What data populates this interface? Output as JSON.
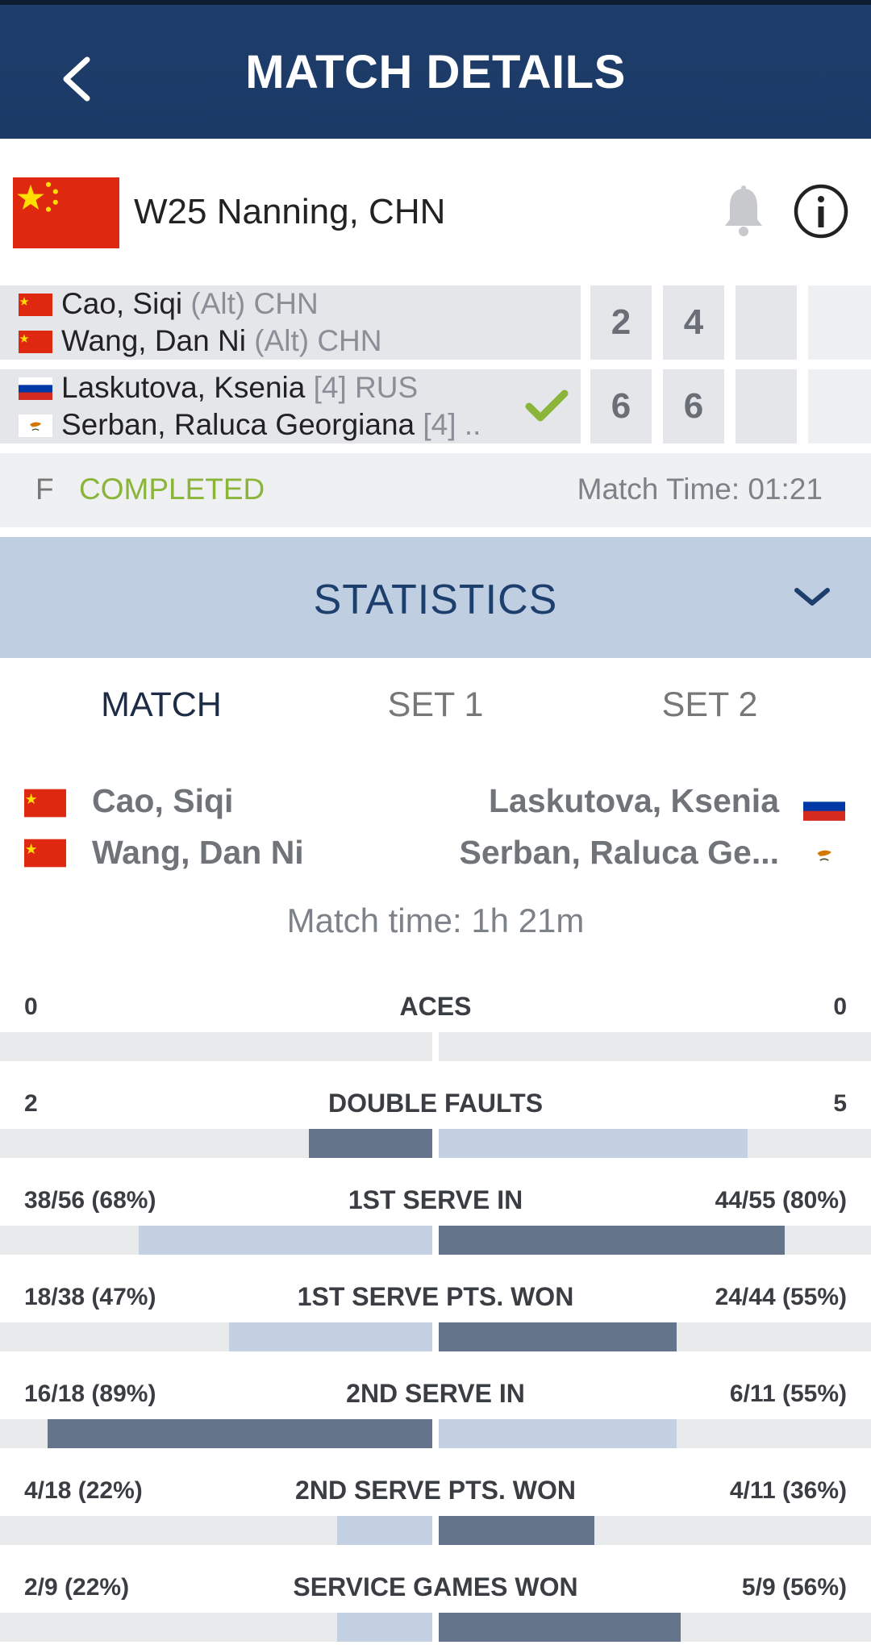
{
  "header": {
    "title": "MATCH DETAILS"
  },
  "tournament": {
    "name": "W25 Nanning, CHN"
  },
  "score": {
    "team1": {
      "p1_name": "Cao, Siqi",
      "p1_tag": " (Alt) CHN",
      "p2_name": "Wang, Dan Ni",
      "p2_tag": " (Alt) CHN",
      "sets": [
        "2",
        "4"
      ]
    },
    "team2": {
      "p1_name": "Laskutova, Ksenia",
      "p1_tag": " [4] RUS",
      "p2_name": "Serban, Raluca Georgiana",
      "p2_tag": " [4] ..",
      "sets": [
        "6",
        "6"
      ],
      "winner": true
    }
  },
  "status": {
    "round": "F",
    "state": "COMPLETED",
    "match_time": "Match Time: 01:21"
  },
  "statistics": {
    "title": "STATISTICS"
  },
  "tabs": [
    "MATCH",
    "SET 1",
    "SET 2"
  ],
  "compare": {
    "left1": "Cao, Siqi",
    "left2": "Wang, Dan Ni",
    "right1": "Laskutova, Ksenia",
    "right2": "Serban, Raluca Ge..."
  },
  "match_time_text": "Match time: 1h 21m",
  "colors": {
    "dark_bar": "#64748b",
    "light_bar": "#c3d1e3",
    "accent_green": "#8ab53a",
    "navy": "#1e3d6b"
  },
  "stats": [
    {
      "label": "ACES",
      "left": "0",
      "right": "0",
      "left_frac": 0.0,
      "right_frac": 0.0,
      "left_dark": false,
      "right_dark": false
    },
    {
      "label": "DOUBLE FAULTS",
      "left": "2",
      "right": "5",
      "left_frac": 0.286,
      "right_frac": 0.714,
      "left_dark": true,
      "right_dark": false
    },
    {
      "label": "1ST SERVE IN",
      "left": "38/56 (68%)",
      "right": "44/55 (80%)",
      "left_frac": 0.68,
      "right_frac": 0.8,
      "left_dark": false,
      "right_dark": true
    },
    {
      "label": "1ST SERVE PTS. WON",
      "left": "18/38 (47%)",
      "right": "24/44 (55%)",
      "left_frac": 0.47,
      "right_frac": 0.55,
      "left_dark": false,
      "right_dark": true
    },
    {
      "label": "2ND SERVE IN",
      "left": "16/18 (89%)",
      "right": "6/11 (55%)",
      "left_frac": 0.89,
      "right_frac": 0.55,
      "left_dark": true,
      "right_dark": false
    },
    {
      "label": "2ND SERVE PTS. WON",
      "left": "4/18 (22%)",
      "right": "4/11 (36%)",
      "left_frac": 0.22,
      "right_frac": 0.36,
      "left_dark": false,
      "right_dark": true
    },
    {
      "label": "SERVICE GAMES WON",
      "left": "2/9 (22%)",
      "right": "5/9 (56%)",
      "left_frac": 0.22,
      "right_frac": 0.56,
      "left_dark": false,
      "right_dark": true
    }
  ]
}
